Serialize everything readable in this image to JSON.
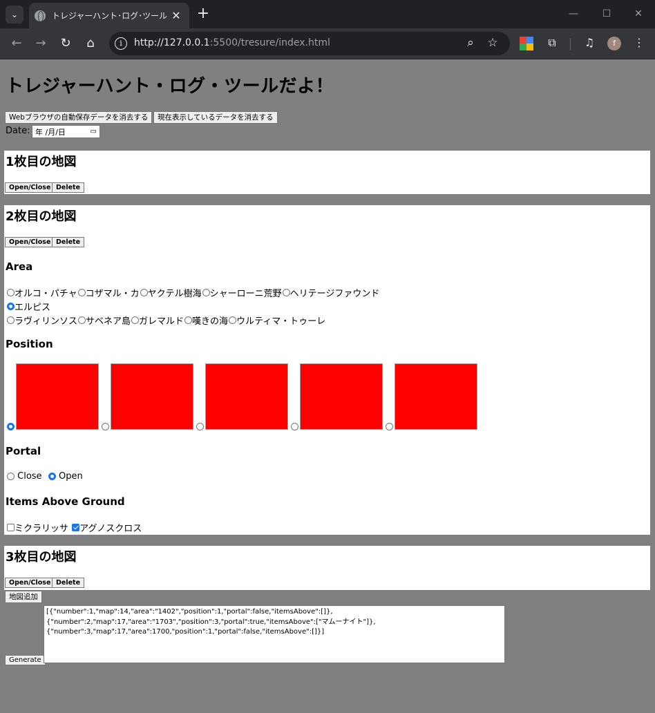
{
  "browser": {
    "tab_title": "トレジャーハント･ログ･ツール",
    "tab_close": "✕",
    "new_tab": "+",
    "url_host": "http://127.0.0.1",
    "url_path": ":5500/tresure/index.html",
    "icons": [
      "tab-search-icon",
      "globe-icon",
      "back-icon",
      "forward-icon",
      "reload-icon",
      "home-icon",
      "info-icon",
      "zoom-icon",
      "star-icon",
      "extension-icon",
      "media-icon",
      "menu-icon"
    ],
    "avatar_letter": "f"
  },
  "page": {
    "title": "トレジャーハント・ログ・ツールだよ！",
    "clear_storage_button": "Webブラウザの自動保存データを消去する",
    "clear_display_button": "現在表示しているデータを消去する",
    "date_label": "Date:",
    "date_placeholder": "年 /月/日",
    "add_map_button": "地図追加",
    "generate_button": "Generate",
    "output_json": "[{\"number\":1,\"map\":14,\"area\":\"1402\",\"position\":1,\"portal\":false,\"itemsAbove\":[]},\n{\"number\":2,\"map\":17,\"area\":\"1703\",\"position\":3,\"portal\":true,\"itemsAbove\":[\"マムーナイト\"]},\n{\"number\":3,\"map\":17,\"area\":1700,\"position\":1,\"portal\":false,\"itemsAbove\":[]}]"
  },
  "maps": [
    {
      "title": "1枚目の地図",
      "open_close": "Open/Close",
      "delete": "Delete"
    },
    {
      "title": "2枚目の地図",
      "open_close": "Open/Close",
      "delete": "Delete",
      "area_heading": "Area",
      "area_rows": [
        [
          "オルコ・パチャ",
          "コザマル・カ",
          "ヤクテル樹海",
          "シャーローニ荒野",
          "ヘリテージファウンド"
        ],
        [
          "エルピス"
        ],
        [
          "ラヴィリンソス",
          "サベネア島",
          "ガレマルド",
          "嘆きの海",
          "ウルティマ・トゥーレ"
        ]
      ],
      "area_selected": "エルピス",
      "position_heading": "Position",
      "positions": [
        1,
        2,
        3,
        4,
        5
      ],
      "position_selected": 1,
      "position_color": "#ff0000",
      "portal_heading": "Portal",
      "portal_close": "Close",
      "portal_open": "Open",
      "portal_selected": "Open",
      "items_heading": "Items Above Ground",
      "item_1": "ミクラリッサ",
      "item_1_checked": false,
      "item_2": "アグノスクロス",
      "item_2_checked": true
    },
    {
      "title": "3枚目の地図",
      "open_close": "Open/Close",
      "delete": "Delete"
    }
  ],
  "colors": {
    "page_bg": "#808080",
    "panel_bg": "#ffffff",
    "radio_accent": "#1a73e8"
  }
}
